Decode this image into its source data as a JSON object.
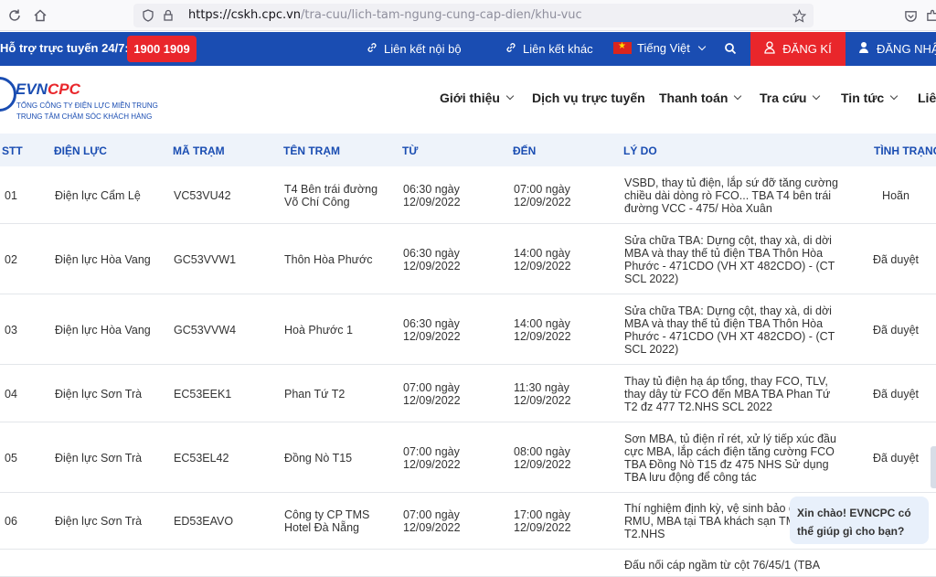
{
  "browser": {
    "url_host": "https://cskh.cpc.vn",
    "url_path": "/tra-cuu/lich-tam-ngung-cung-cap-dien/khu-vuc"
  },
  "topbar": {
    "hotline_label": "Hỗ trợ trực tuyến 24/7:",
    "hotline_number": "1900 1909",
    "link_internal": "Liên kết nội bộ",
    "link_other": "Liên kết khác",
    "language": "Tiếng Việt",
    "register": "ĐĂNG KÍ",
    "login": "ĐĂNG NHẬP"
  },
  "logo": {
    "name_a": "EVN",
    "name_b": "CPC",
    "sub1": "TỔNG CÔNG TY ĐIỆN LỰC MIỀN TRUNG",
    "sub2": "TRUNG TÂM CHĂM SÓC KHÁCH HÀNG"
  },
  "nav": [
    "Giới thiệu",
    "Dịch vụ trực tuyến",
    "Thanh toán",
    "Tra cứu",
    "Tin tức",
    "Liên hệ"
  ],
  "table": {
    "headers": [
      "STT",
      "ĐIỆN LỰC",
      "MÃ TRẠM",
      "TÊN TRẠM",
      "TỪ",
      "ĐẾN",
      "LÝ DO",
      "TÌNH TRẠNG"
    ],
    "rows": [
      {
        "stt": "01",
        "dienluc": "Điện lực Cẩm Lệ",
        "ma": "VC53VU42",
        "ten": [
          "T4 Bên trái đường",
          "Võ Chí Công"
        ],
        "tu": [
          "06:30 ngày",
          "12/09/2022"
        ],
        "den": [
          "07:00 ngày",
          "12/09/2022"
        ],
        "lydo": [
          "VSBD, thay tủ điện, lắp sứ đỡ tăng cường",
          "chiều dài dòng rò FCO... TBA T4 bên trái",
          "đường VCC - 475/ Hòa Xuân"
        ],
        "tinhtrang": "Hoãn"
      },
      {
        "stt": "02",
        "dienluc": "Điện lực Hòa Vang",
        "ma": "GC53VVW1",
        "ten": [
          "Thôn Hòa Phước"
        ],
        "tu": [
          "06:30 ngày",
          "12/09/2022"
        ],
        "den": [
          "14:00 ngày",
          "12/09/2022"
        ],
        "lydo": [
          "Sửa chữa TBA: Dựng cột, thay xà, di dời",
          "MBA và thay thế tủ điện TBA Thôn Hòa",
          "Phước - 471CDO (VH XT 482CDO) - (CT",
          "SCL 2022)"
        ],
        "tinhtrang": "Đã duyệt"
      },
      {
        "stt": "03",
        "dienluc": "Điện lực Hòa Vang",
        "ma": "GC53VVW4",
        "ten": [
          "Hoà Phước 1"
        ],
        "tu": [
          "06:30 ngày",
          "12/09/2022"
        ],
        "den": [
          "14:00 ngày",
          "12/09/2022"
        ],
        "lydo": [
          "Sửa chữa TBA: Dựng cột, thay xà, di dời",
          "MBA và thay thế tủ điện TBA Thôn Hòa",
          "Phước - 471CDO (VH XT 482CDO) - (CT",
          "SCL 2022)"
        ],
        "tinhtrang": "Đã duyệt"
      },
      {
        "stt": "04",
        "dienluc": "Điện lực Sơn Trà",
        "ma": "EC53EEK1",
        "ten": [
          "Phan Tứ T2"
        ],
        "tu": [
          "07:00 ngày",
          "12/09/2022"
        ],
        "den": [
          "11:30 ngày",
          "12/09/2022"
        ],
        "lydo": [
          "Thay tủ điện hạ áp tổng, thay FCO, TLV,",
          "thay dây từ FCO đến MBA TBA Phan Tứ",
          "T2 đz 477 T2.NHS SCL 2022"
        ],
        "tinhtrang": "Đã duyệt"
      },
      {
        "stt": "05",
        "dienluc": "Điện lực Sơn Trà",
        "ma": "EC53EL42",
        "ten": [
          "Đồng Nò T15"
        ],
        "tu": [
          "07:00 ngày",
          "12/09/2022"
        ],
        "den": [
          "08:00 ngày",
          "12/09/2022"
        ],
        "lydo": [
          "Sơn MBA, tủ điện rỉ rét, xử lý tiếp xúc đầu",
          "cực MBA, lắp cách điện tăng cường FCO",
          "TBA Đồng Nò T15 đz 475 NHS Sử dụng",
          "TBA lưu động để công tác"
        ],
        "tinhtrang": "Đã duyệt"
      },
      {
        "stt": "06",
        "dienluc": "Điện lực Sơn Trà",
        "ma": "ED53EAVO",
        "ten": [
          "Công ty CP TMS",
          "Hotel Đà Nẵng"
        ],
        "tu": [
          "07:00 ngày",
          "12/09/2022"
        ],
        "den": [
          "17:00 ngày",
          "12/09/2022"
        ],
        "lydo": [
          "Thí nghiệm định kỳ, vệ sinh bảo du",
          "RMU, MBA tại TBA khách sạn TMS",
          "T2.NHS"
        ],
        "tinhtrang": ""
      },
      {
        "stt": "",
        "dienluc": "",
        "ma": "",
        "ten": [],
        "tu": [],
        "den": [],
        "lydo": [
          "Đấu nối cáp ngầm từ cột 76/45/1 (TBA"
        ],
        "tinhtrang": ""
      }
    ]
  },
  "chat": {
    "line1": "Xin chào! EVNCPC có",
    "line2": "thể giúp gì cho bạn?"
  }
}
